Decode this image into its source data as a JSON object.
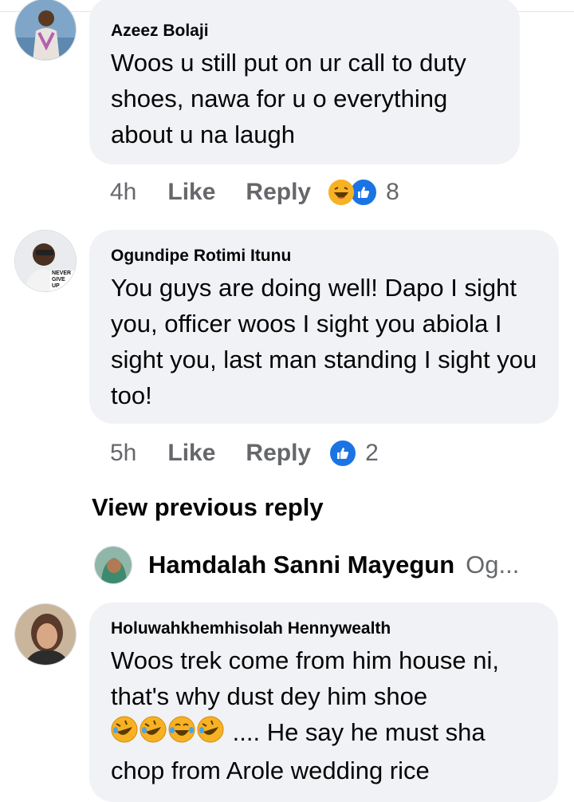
{
  "comments": [
    {
      "author": "Azeez Bolaji",
      "text": "Woos u still put on ur call to duty shoes, nawa for u o everything about u na laugh",
      "time": "4h",
      "like_label": "Like",
      "reply_label": "Reply",
      "reaction_icons": [
        "haha-icon",
        "like-icon"
      ],
      "reaction_count": "8"
    },
    {
      "author": "Ogundipe Rotimi Itunu",
      "avatar_text": "NEVER GIVE UP",
      "text": "You guys are doing well! Dapo I sight you, officer woos I sight you abiola I sight you, last man standing I sight you too!",
      "time": "5h",
      "like_label": "Like",
      "reply_label": "Reply",
      "reaction_icons": [
        "like-icon"
      ],
      "reaction_count": "2"
    }
  ],
  "view_previous_reply": "View previous reply",
  "collapsed_reply": {
    "author": "Hamdalah Sanni Mayegun",
    "preview": "Og..."
  },
  "last_comment": {
    "author": "Holuwahkhemhisolah Hennywealth",
    "text_line1": "Woos trek come from him house ni,",
    "text_line2": "that's why dust dey him shoe",
    "text_line3_after_emoji": ".... He say he must sha",
    "text_line4": "chop from Arole wedding rice",
    "inline_emojis": [
      "rofl-icon",
      "rofl-icon",
      "joy-icon",
      "rofl-icon"
    ]
  },
  "colors": {
    "bubble": "#f0f2f5",
    "meta_text": "#65676b",
    "like_blue": "#1b74e4",
    "haha_yellow": "#f7b125"
  }
}
